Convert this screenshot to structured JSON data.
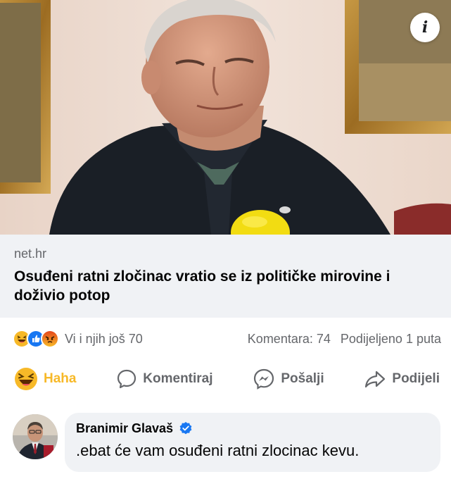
{
  "post": {
    "photo_alt": "",
    "info_icon": "info-icon",
    "link": {
      "domain": "net.hr",
      "title": "Osuđeni ratni zločinac vratio se iz političke mirovine i doživio potop"
    }
  },
  "reactions": {
    "icons": [
      "haha-icon",
      "like-icon",
      "angry-icon"
    ],
    "names": "Vi i njih još 70",
    "comments": "Komentara: 74",
    "shares": "Podijeljeno 1 puta"
  },
  "actions": [
    {
      "label": "Haha",
      "icon": "haha-icon",
      "active": true,
      "color": "#f7b928"
    },
    {
      "label": "Komentiraj",
      "icon": "comment-icon"
    },
    {
      "label": "Pošalji",
      "icon": "messenger-icon"
    },
    {
      "label": "Podijeli",
      "icon": "share-icon"
    }
  ],
  "comment": {
    "author": "Branimir Glavaš",
    "verified_icon": "verified-badge-icon",
    "text": ".ebat će vam osuđeni ratni zlocinac kevu."
  },
  "colors": {
    "haha": "#f7b928",
    "like": "#1877f2",
    "angry": "#e9710f",
    "verified": "#1877f2",
    "muted_text": "#65676b",
    "card_bg": "#f0f2f5"
  }
}
